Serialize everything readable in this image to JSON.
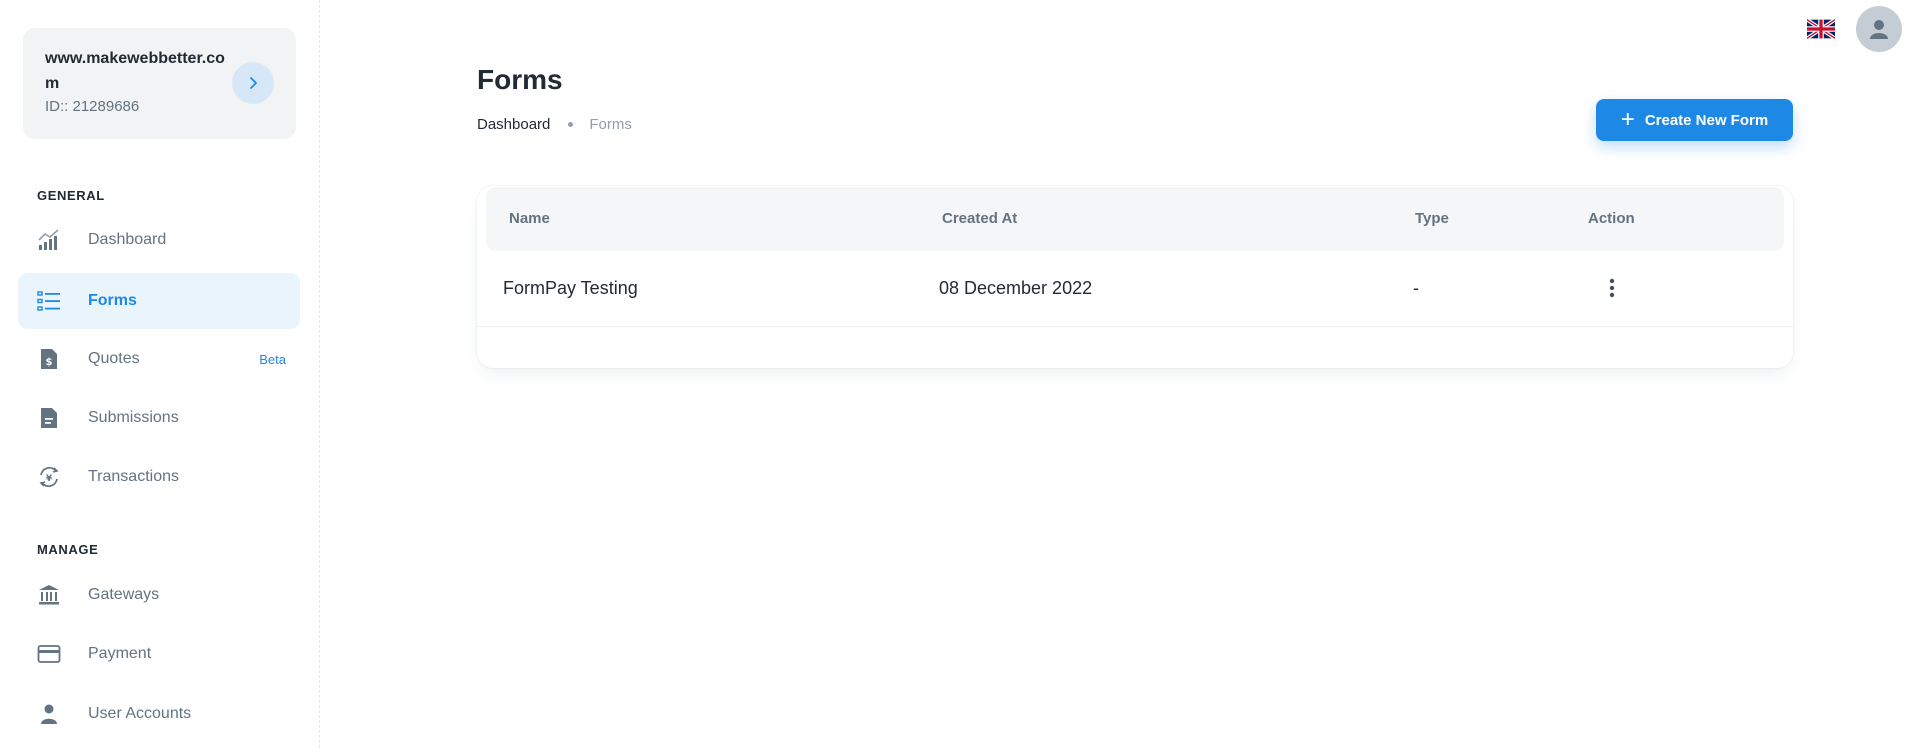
{
  "account": {
    "domain": "www.makewebbetter.com",
    "id_label": "ID:: 21289686"
  },
  "sidebar": {
    "general_label": "GENERAL",
    "manage_label": "MANAGE",
    "items": [
      {
        "label": "Dashboard",
        "icon": "chart-icon"
      },
      {
        "label": "Forms",
        "icon": "list-icon",
        "active": true
      },
      {
        "label": "Quotes",
        "icon": "invoice-icon",
        "badge": "Beta"
      },
      {
        "label": "Submissions",
        "icon": "document-icon"
      },
      {
        "label": "Transactions",
        "icon": "currency-exchange-icon"
      },
      {
        "label": "Gateways",
        "icon": "bank-icon"
      },
      {
        "label": "Payment",
        "icon": "credit-card-icon"
      },
      {
        "label": "User Accounts",
        "icon": "user-icon"
      }
    ]
  },
  "header": {
    "title": "Forms",
    "breadcrumb": [
      "Dashboard",
      "Forms"
    ],
    "create_button": "Create New Form"
  },
  "table": {
    "columns": [
      "Name",
      "Created At",
      "Type",
      "Action"
    ],
    "rows": [
      {
        "name": "FormPay Testing",
        "created_at": "08 December 2022",
        "type": "-"
      }
    ]
  },
  "colors": {
    "accent": "#1e88e5",
    "active_bg": "#e9f4fd",
    "muted_text": "#637381"
  }
}
